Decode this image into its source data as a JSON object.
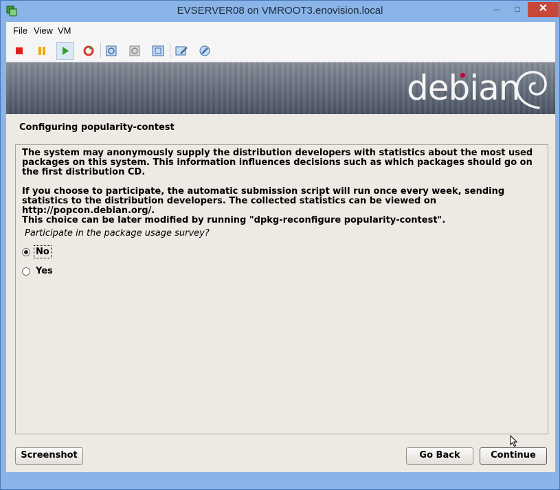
{
  "window": {
    "title": "EVSERVER08 on VMROOT3.enovision.local",
    "controls": {
      "minimize": "–",
      "maximize": "□",
      "close": "✕"
    }
  },
  "menu": [
    "File",
    "View",
    "VM"
  ],
  "toolbar": {
    "icons": [
      "stop-icon",
      "pause-icon",
      "play-icon",
      "reset-icon",
      "snapshot-icon",
      "revert-snapshot-icon",
      "manage-snapshots-icon",
      "settings-icon",
      "tools-icon"
    ],
    "colors": {
      "stop": "#e02020",
      "pause": "#f0a800",
      "play": "#30a030",
      "reset": "#d83a2a"
    }
  },
  "banner": {
    "logo_text": "debian",
    "dot_color": "#c70036"
  },
  "installer": {
    "step_title": "Configuring popularity-contest",
    "paragraphs": [
      "The system may anonymously supply the distribution developers with statistics about the most used packages on this system. This information influences decisions such as which packages should go on the first distribution CD.",
      "If you choose to participate, the automatic submission script will run once every week, sending statistics to the distribution developers. The collected statistics can be viewed on http://popcon.debian.org/.",
      "This choice can be later modified by running \"dpkg-reconfigure popularity-contest\"."
    ],
    "question": "Participate in the package usage survey?",
    "options": [
      {
        "label": "No",
        "selected": true
      },
      {
        "label": "Yes",
        "selected": false
      }
    ],
    "buttons": {
      "screenshot": "Screenshot",
      "go_back": "Go Back",
      "continue": "Continue"
    }
  }
}
